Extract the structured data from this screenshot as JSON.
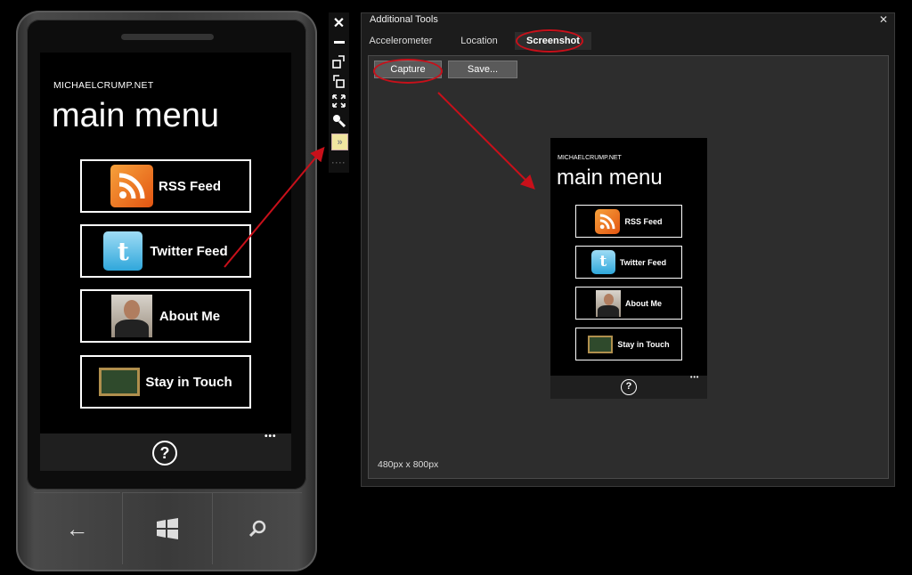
{
  "phone": {
    "site_name": "MICHAELCRUMP.NET",
    "page_title": "main menu",
    "menu_items": [
      {
        "label": "RSS Feed",
        "icon": "rss-icon"
      },
      {
        "label": "Twitter Feed",
        "icon": "twitter-icon"
      },
      {
        "label": "About Me",
        "icon": "profile-photo"
      },
      {
        "label": "Stay in Touch",
        "icon": "chalkboard-icon"
      }
    ],
    "appbar": {
      "help_glyph": "?",
      "more_glyph": "•••"
    },
    "hardware": {
      "back_glyph": "←",
      "search_glyph": "⚲"
    }
  },
  "toolbar": {
    "items": [
      "close-icon",
      "minimize-icon",
      "rotate-left-icon",
      "rotate-right-icon",
      "fit-icon",
      "zoom-icon",
      "additional-tools-icon",
      "grip-icon"
    ]
  },
  "tools_window": {
    "title": "Additional Tools",
    "close_glyph": "✕",
    "tabs": [
      "Accelerometer",
      "Location",
      "Screenshot"
    ],
    "active_tab": "Screenshot",
    "capture_label": "Capture",
    "save_label": "Save...",
    "resolution": "480px x 800px",
    "preview": {
      "site_name": "MICHAELCRUMP.NET",
      "page_title": "main menu",
      "menu_items": [
        "RSS Feed",
        "Twitter Feed",
        "About Me",
        "Stay in Touch"
      ],
      "help_glyph": "?",
      "more_glyph": "•••"
    }
  },
  "colors": {
    "annotation_red": "#c8101a",
    "window_bg": "#2d2d2d",
    "button_bg": "#5a5a5a"
  }
}
